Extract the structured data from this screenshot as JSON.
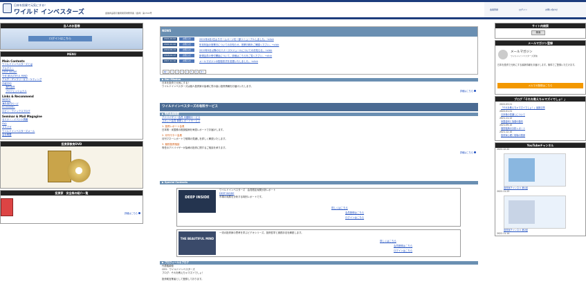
{
  "header": {
    "sub": "日本を投資で元気にする！",
    "title": "ワイルド インベスターズ",
    "desc": "金融商品取引業者関東財務局長（金商）第1502号",
    "links": [
      "会員登録",
      "ログイン",
      "お問い合わせ"
    ]
  },
  "left": {
    "member_title": "当人のお客様",
    "member_button": "ログインはこちら",
    "menu_title": "MENU",
    "menu_main_heading": "Main Contents",
    "menu_main": [
      "ワイルドインベスターズとは",
      "アカデミー",
      "DEEP INSIDE",
      "THE BEAUTIFUL MIND",
      "アルチ・ギャラリー＆マーケティング",
      "日経平均",
      "海外投資",
      "プロフェッショナル"
    ],
    "menu_links_heading": "Links & Recommend",
    "menu_links": [
      "WEBTV",
      "海外専門ページ",
      "ECONOMIC",
      "ロビン・ウイックスブログ"
    ],
    "menu_seminar_heading": "Seminar & Mail Magagine",
    "menu_seminar": [
      "セミナー・イベント情報",
      "FAQ",
      "メルマガ",
      "ワイルドインベスターズメール",
      "会社概要"
    ],
    "edu_title": "投資家教育DVD",
    "books_title": "投資家　安全株の紹介一覧",
    "more": "詳細はこちら"
  },
  "news": {
    "title": "NEWS",
    "rows": [
      {
        "date": "2021.04.02",
        "tag": "お知らせ",
        "text": "2021年4月2日よりホームページを一部リニューアルしました。→click"
      },
      {
        "date": "2020.12.22",
        "tag": "お知らせ",
        "text": "年末年始の営業日についてのお知らせ。営業日程をご確認ください。→click"
      },
      {
        "date": "2019.09.13",
        "tag": "お知らせ",
        "text": "2019年9月以降のセミナースケジュールについてのお知らせ。→click"
      },
      {
        "date": "2018.04.17",
        "tag": "お知らせ",
        "text": "新規会員の受付開始について。詳細はこちらをご覧ください。→click"
      },
      {
        "date": "2017.11.10",
        "tag": "お知らせ",
        "text": "メールマガジンの配信形式を変更いたしました。→click"
      }
    ],
    "pager": [
      "前へ",
      "1",
      "2",
      "3",
      "4",
      "5",
      "6",
      "次へ"
    ]
  },
  "our_mission": {
    "title": "▶ Our Mission",
    "heading": "日本を投資で元気にする！",
    "body": "ワイルドインベスターズは個人投資家の皆様に質の高い投資情報をお届けいたします。",
    "more": "詳細はこちら"
  },
  "services": {
    "title": "ワイルドインベスターズの有料サービス",
    "sub": "▶ 有料会員制度",
    "links": [
      "アドバイザリー会員 月額制サービス",
      "スポット会員 単発レポートサービス"
    ],
    "items": [
      {
        "h": "1. 投資レポート会員",
        "t": "日本株・米国株の推奨銘柄を毎週レポートでお届けします。"
      },
      {
        "h": "2. 月刊マネー会員",
        "t": "月刊マネーレポートで相場の見通しを詳しく解説いたします。"
      },
      {
        "h": "3. 個別投資相談",
        "t": "専任のアドバイザーが皆様の投資に関するご相談を承ります。"
      }
    ],
    "more": "詳細はこちら"
  },
  "special": {
    "title": "▶ Special Contents",
    "deep": {
      "img": "DEEP INSIDE",
      "label": "DEEP INSIDE",
      "text": "ワイルドインベスターズ　会員限定深層分析レポート",
      "desc": "市場の深層を分析する特別レポートです。",
      "links": [
        "詳しくはこちら",
        "会員登録はこちら",
        "ログインはこちら"
      ]
    },
    "mind": {
      "img": "THE BEAUTIFUL MIND",
      "text": "一流の投資家の思考を学ぶビデオシリーズ。投資哲学と実践手法を解説します。",
      "links": [
        "詳しくはこちら",
        "会員登録はこちら",
        "ログインはこちら"
      ]
    }
  },
  "profile": {
    "title": "▶ プロフィール＆ブログ",
    "name": "代表取締役",
    "lines": [
      "CEO：ワイルドインベスターズ",
      "ブログ：それを教えちゃマズイでしょ！",
      "投資助言業者として登録しております。"
    ]
  },
  "right": {
    "search_title": "サイト内検索",
    "search_button": "検索",
    "mail_title": "メールマガジン登録",
    "mail_name": "メールマガジン",
    "mail_sub": "ワイルドインベスターズ通信",
    "mail_text": "日本を投資で元気にする最新情報をお届けします。無料でご登録いただけます。",
    "mail_button": "メルマガ登録はこちら",
    "blog_title": "ブログ「それを教えちゃマズイでしょ！」",
    "blog": [
      {
        "d": "2022.03.21",
        "t": "「それを教えちゃマズイでしょ！」最新記事"
      },
      {
        "d": "2022.01.21",
        "t": "日本株の見通しについて"
      },
      {
        "d": "2021.11.12",
        "t": "米国金利と為替の動向"
      },
      {
        "d": "2021.09.10",
        "t": "個別銘柄の分析レポート"
      },
      {
        "d": "2021.12.10",
        "t": "投資家心理と相場の関係"
      }
    ],
    "yt_title": "YouTubeチャンネル",
    "videos": [
      {
        "d": "2022.12.22",
        "cap": "投資家チャンネル 第1回"
      },
      {
        "d": "2022.11.23",
        "cap": "投資家チャンネル 第2回"
      },
      {
        "d": "2022.11.14",
        "cap": "投資家チャンネル 第3回"
      }
    ]
  }
}
